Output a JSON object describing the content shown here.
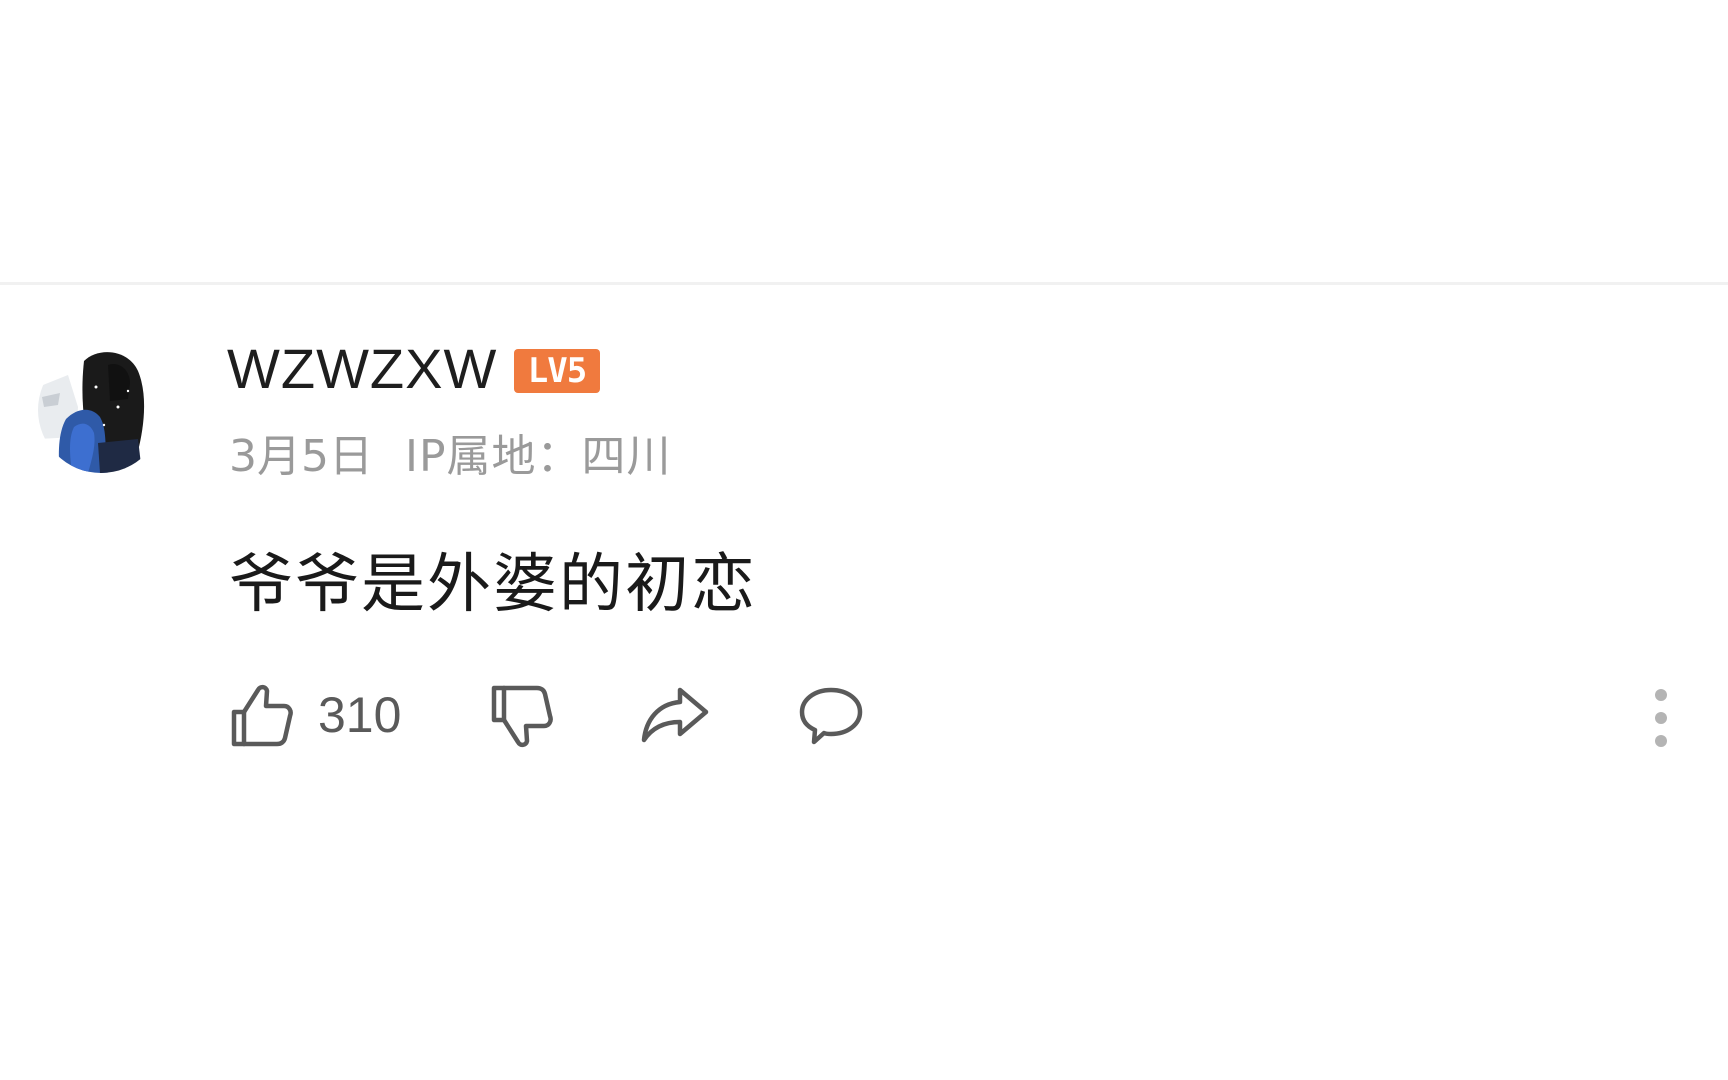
{
  "comment": {
    "username": "WZWZXW",
    "level_badge": "LV5",
    "date": "3月5日",
    "ip_location": "IP属地：四川",
    "text": "爷爷是外婆的初恋",
    "like_count": "310"
  },
  "icons": {
    "like": "thumbs-up-icon",
    "dislike": "thumbs-down-icon",
    "share": "share-arrow-icon",
    "reply": "speech-bubble-icon",
    "more": "more-vertical-icon"
  },
  "colors": {
    "level_badge": "#f07a3e",
    "username": "#1e1e1e",
    "meta": "#9a9a9a",
    "icon": "#5a5a5a"
  }
}
